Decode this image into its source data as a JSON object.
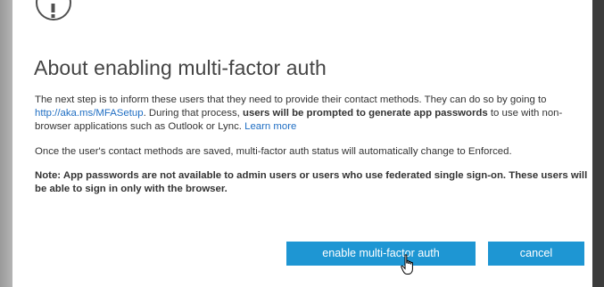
{
  "dialog": {
    "title": "About enabling multi-factor auth",
    "icon": "exclamation-circle-icon",
    "paragraph1": {
      "text_a": "The next step is to inform these users that they need to provide their contact methods. They can do so by going to",
      "link_url": "http://aka.ms/MFASetup",
      "text_b": ". During that process,",
      "bold": "users will be prompted to generate app passwords",
      "text_c": "to use with non-browser applications such as Outlook or Lync.",
      "learn_more": "Learn more"
    },
    "paragraph2": "Once the user's contact methods are saved, multi-factor auth status will automatically change to Enforced.",
    "note": "Note: App passwords are not available to admin users or users who use federated single sign-on. These users will be able to sign in only with the browser.",
    "buttons": {
      "enable": "enable multi-factor auth",
      "cancel": "cancel"
    }
  },
  "colors": {
    "accent": "#1e96d3",
    "link": "#1f6ec3",
    "title": "#444444"
  }
}
